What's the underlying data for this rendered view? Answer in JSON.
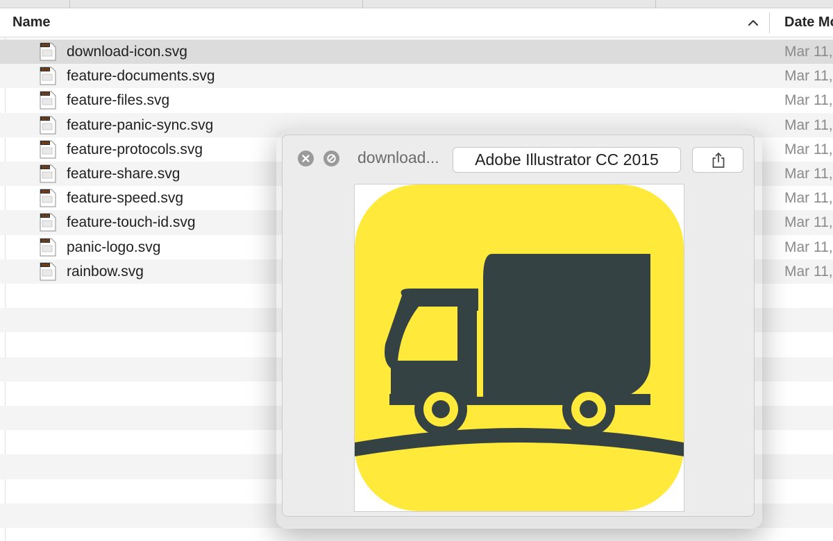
{
  "header": {
    "name_label": "Name",
    "date_label": "Date Mo",
    "sort_icon": "chevron-up-icon"
  },
  "files": [
    {
      "name": "download-icon.svg",
      "date": "Mar 11,",
      "icon": "svg-file-icon",
      "selected": true
    },
    {
      "name": "feature-documents.svg",
      "date": "Mar 11,",
      "icon": "svg-file-icon"
    },
    {
      "name": "feature-files.svg",
      "date": "Mar 11,",
      "icon": "svg-file-icon"
    },
    {
      "name": "feature-panic-sync.svg",
      "date": "Mar 11,",
      "icon": "svg-file-icon"
    },
    {
      "name": "feature-protocols.svg",
      "date": "Mar 11,",
      "icon": "svg-file-icon"
    },
    {
      "name": "feature-share.svg",
      "date": "Mar 11,",
      "icon": "svg-file-icon"
    },
    {
      "name": "feature-speed.svg",
      "date": "Mar 11,",
      "icon": "svg-file-icon"
    },
    {
      "name": "feature-touch-id.svg",
      "date": "Mar 11,",
      "icon": "svg-file-icon"
    },
    {
      "name": "panic-logo.svg",
      "date": "Mar 11,",
      "icon": "svg-file-icon"
    },
    {
      "name": "rainbow.svg",
      "date": "Mar 11,",
      "icon": "svg-file-icon"
    }
  ],
  "file_icon_badge": "SVG",
  "quicklook": {
    "title": "download...",
    "open_with_label": "Adobe Illustrator CC 2015",
    "close_icon": "close-icon",
    "fullscreen_icon": "fullscreen-icon",
    "share_icon": "share-icon",
    "preview": {
      "subject": "delivery-truck-icon",
      "background_color": "#FFE93A",
      "foreground_color": "#354244"
    }
  },
  "colors": {
    "selection": "#DCDCDC",
    "stripe": "#F4F4F4",
    "date_text": "#8A8A8A"
  }
}
